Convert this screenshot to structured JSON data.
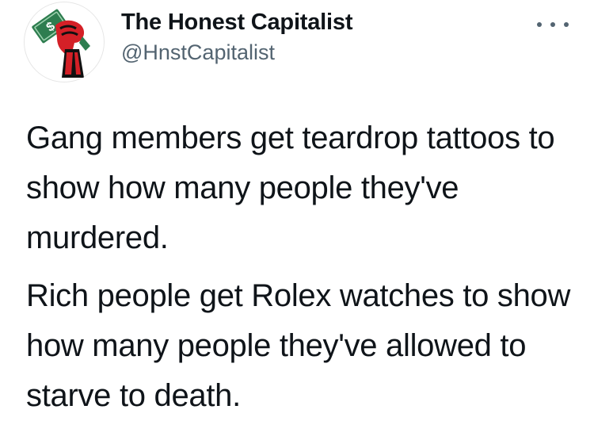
{
  "account": {
    "display_name": "The Honest Capitalist",
    "handle": "@HnstCapitalist",
    "avatar_icon": "raised-fist-holding-money-icon"
  },
  "menu": {
    "icon": "more-options-icon"
  },
  "tweet": {
    "paragraphs": [
      "Gang members get teardrop tattoos to show how many people they've murdered.",
      "Rich people get Rolex watches to show how many people they've allowed to starve to death."
    ]
  },
  "colors": {
    "text": "#0f1419",
    "secondary": "#536471",
    "fist_red": "#d42027",
    "money_green": "#2e7d4f"
  }
}
